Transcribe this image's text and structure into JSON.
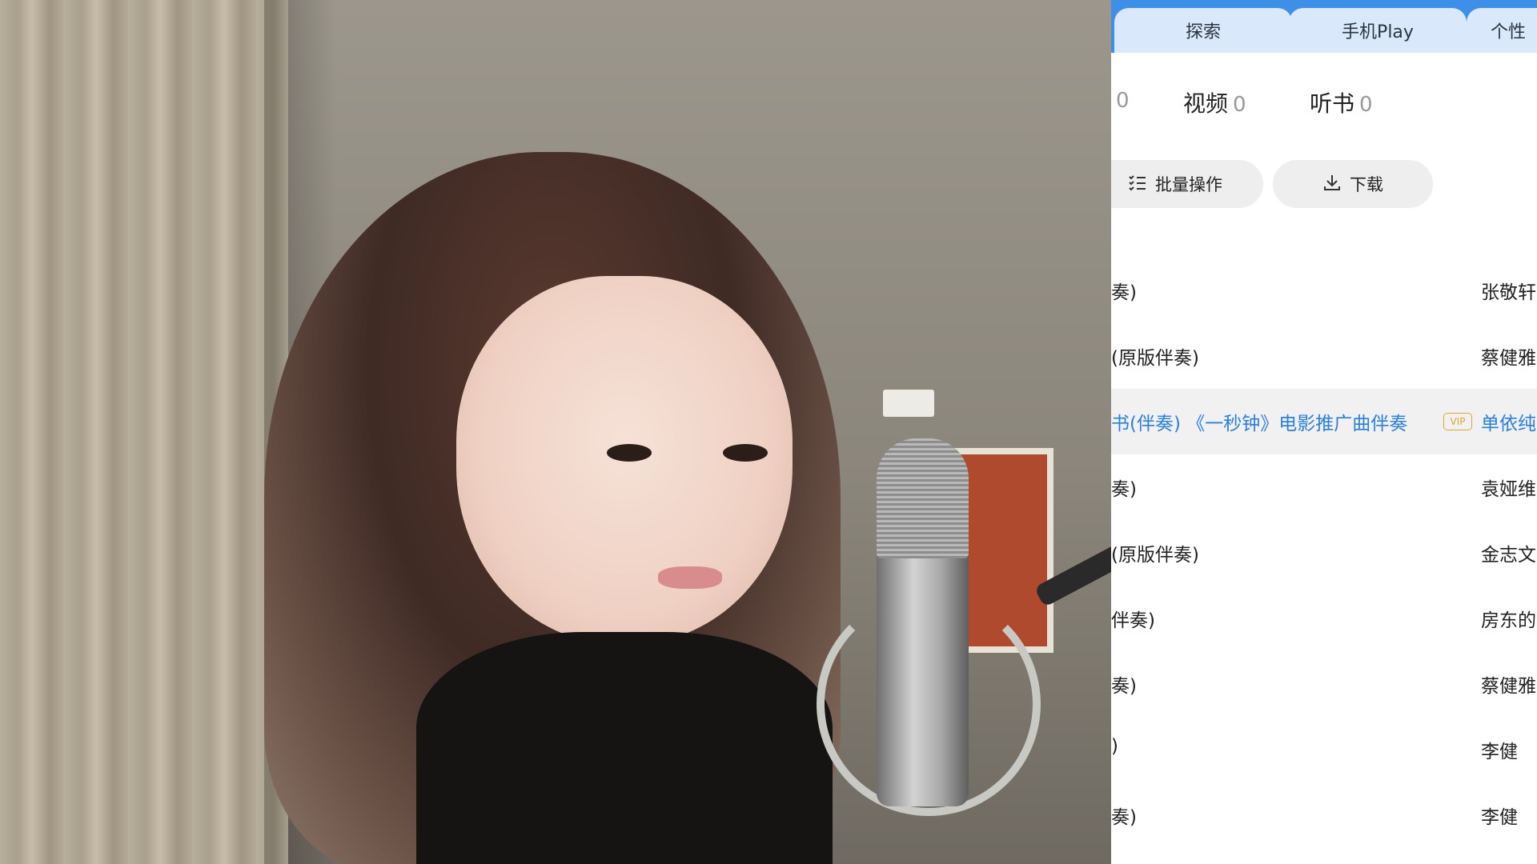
{
  "colors": {
    "accent": "#3d8fe8",
    "link_blue": "#2a7fe2",
    "vip_gold": "#e6a52b"
  },
  "tabs": [
    "探索",
    "手机Play",
    "个性"
  ],
  "counts": [
    {
      "label": "",
      "value": "0"
    },
    {
      "label": "视频",
      "value": "0"
    },
    {
      "label": "听书",
      "value": "0"
    }
  ],
  "toolbar": {
    "batch_label": "批量操作",
    "batch_icon": "list-checklist-icon",
    "download_label": "下载",
    "download_icon": "download-icon"
  },
  "songs": [
    {
      "title": "奏)",
      "artist": "张敬轩",
      "vip": false,
      "active": false
    },
    {
      "title": "(原版伴奏)",
      "artist": "蔡健雅",
      "vip": false,
      "active": false
    },
    {
      "title": "书(伴奏) 《一秒钟》电影推广曲伴奏",
      "artist": "单依纯",
      "vip": true,
      "vip_label": "VIP",
      "active": true
    },
    {
      "title": "奏)",
      "artist": "袁娅维",
      "vip": false,
      "active": false
    },
    {
      "title": "(原版伴奏)",
      "artist": "金志文",
      "vip": false,
      "active": false
    },
    {
      "title": "伴奏)",
      "artist": "房东的",
      "vip": false,
      "active": false
    },
    {
      "title": "奏)",
      "artist": "蔡健雅",
      "vip": false,
      "active": false
    },
    {
      "title": ")",
      "artist": "李健",
      "vip": false,
      "active": false
    },
    {
      "title": "奏)",
      "artist": "李健",
      "vip": false,
      "active": false
    }
  ]
}
